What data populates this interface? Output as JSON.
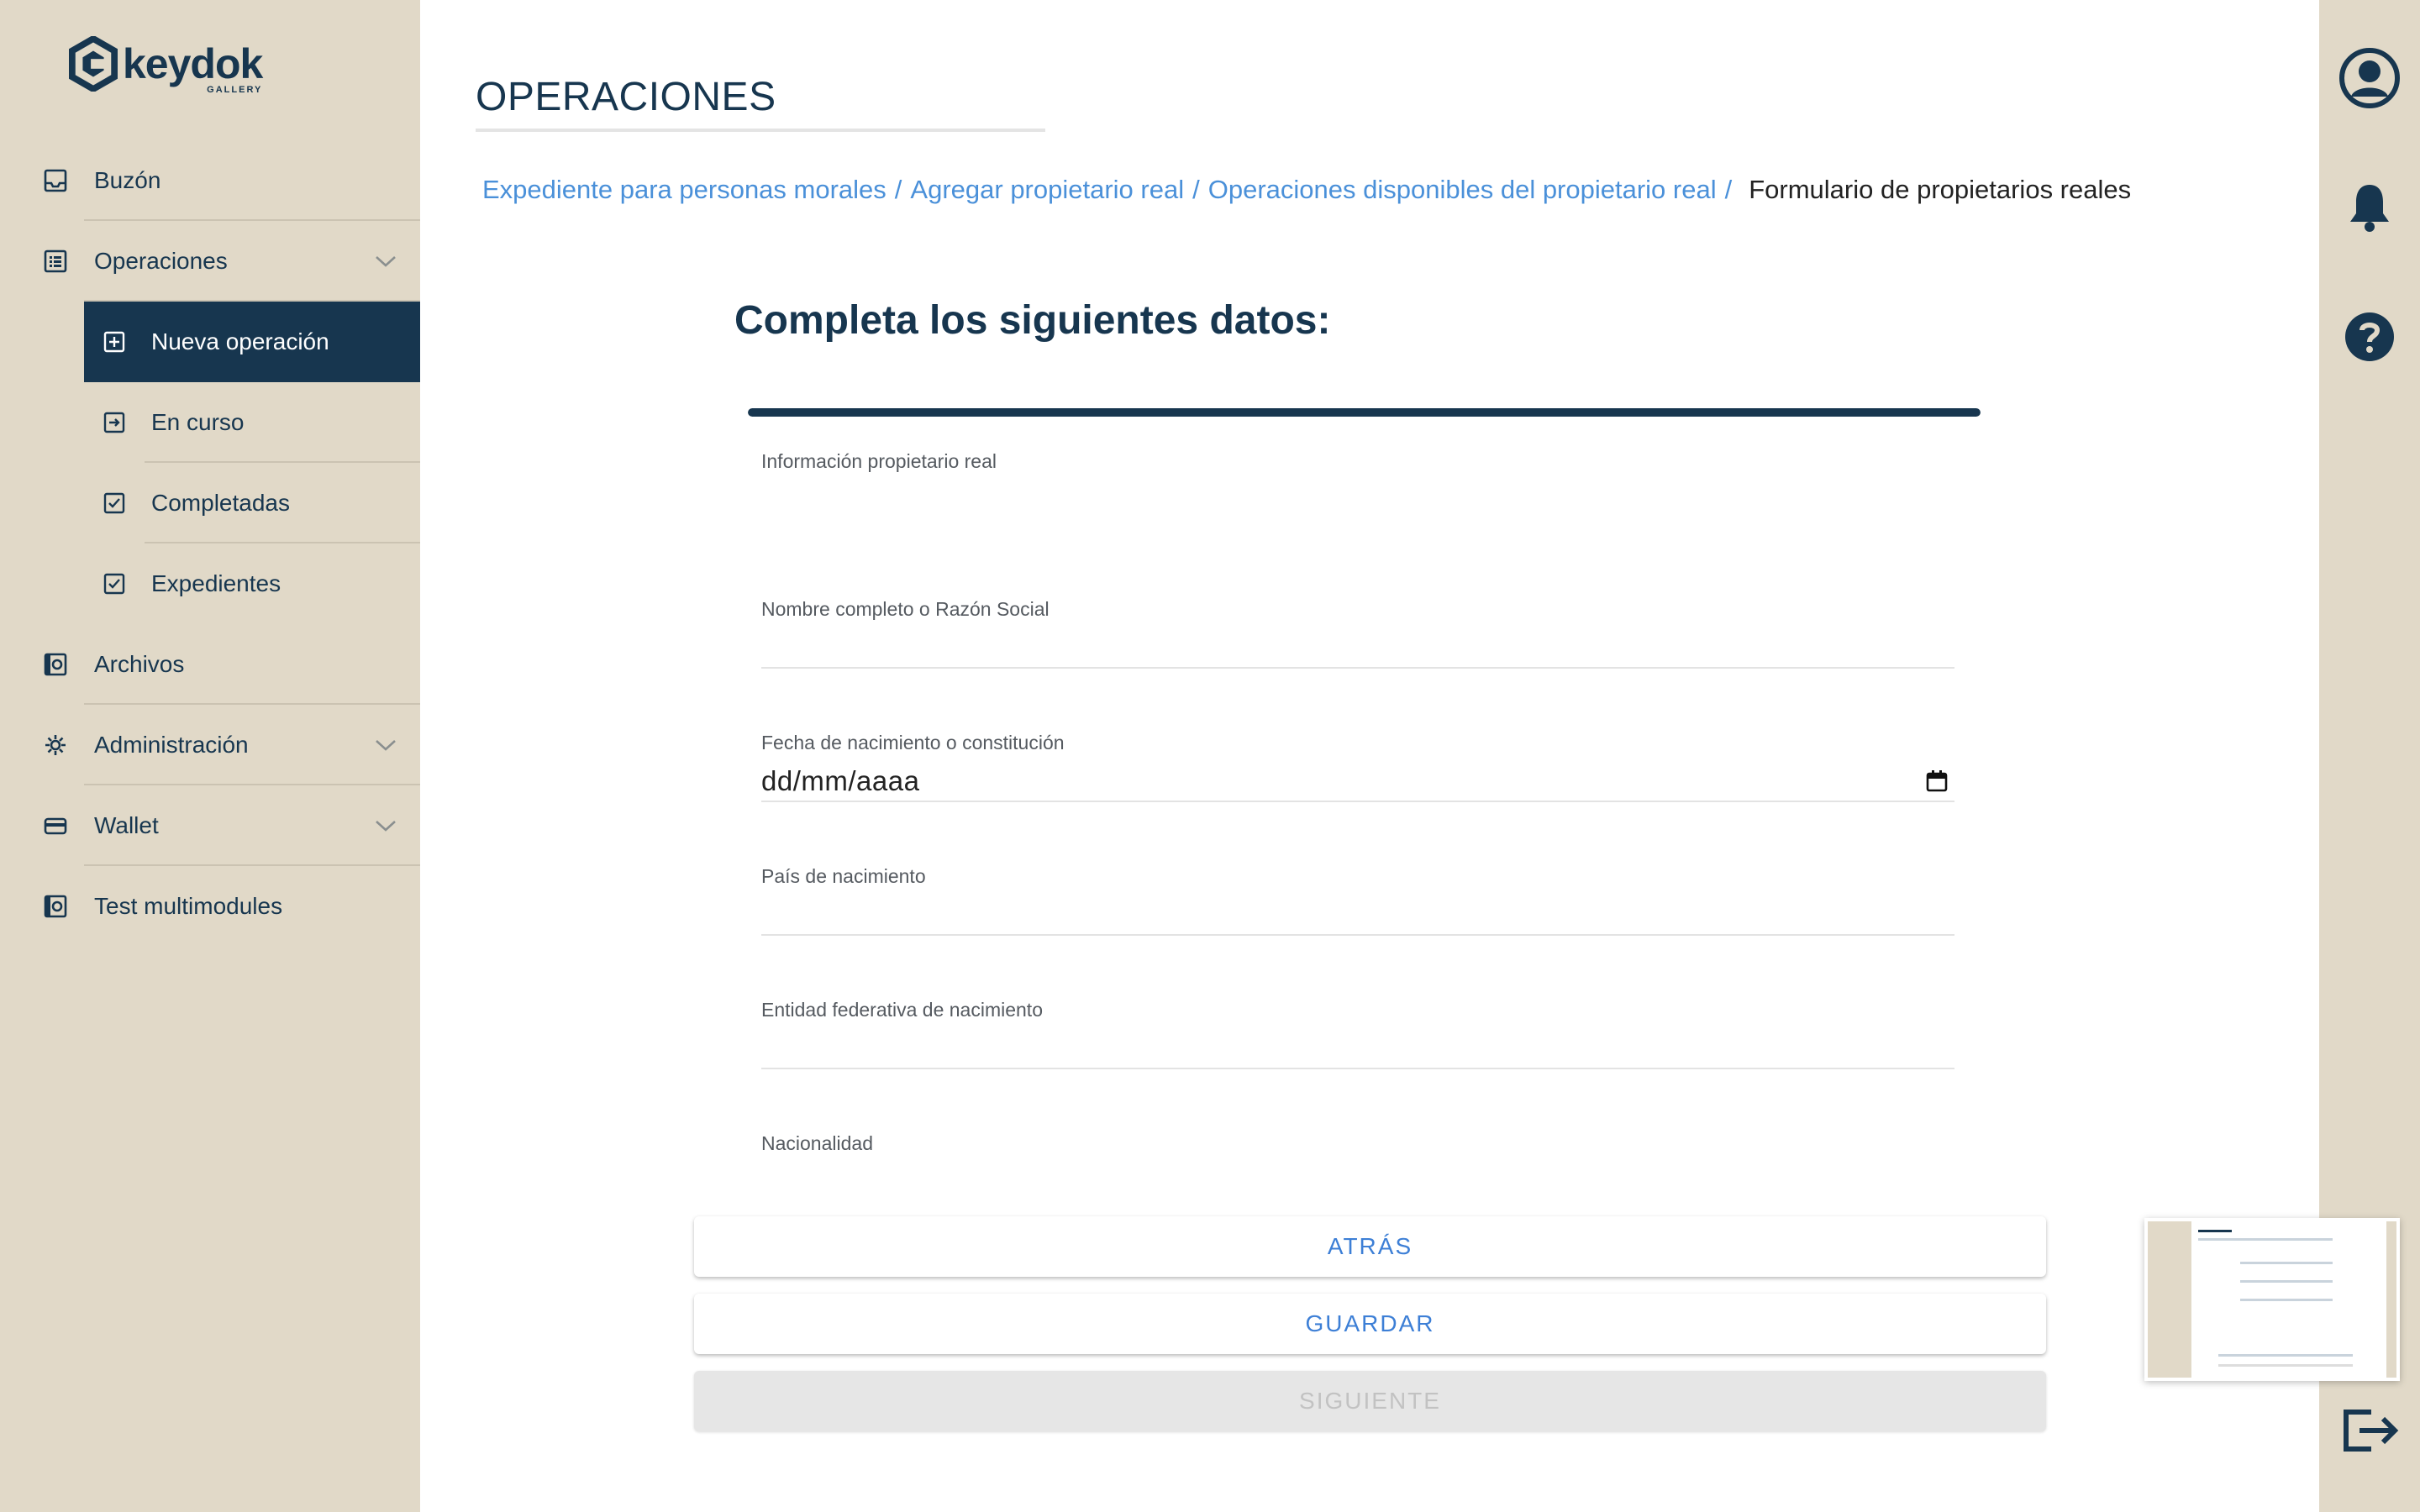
{
  "brand": {
    "name": "keydok",
    "subtitle": "GALLERY"
  },
  "sidebar": {
    "items": [
      {
        "label": "Buzón",
        "icon": "inbox-icon"
      },
      {
        "label": "Operaciones",
        "icon": "list-icon",
        "expanded": true
      },
      {
        "label": "Nueva operación",
        "icon": "plus-square-icon",
        "active": true
      },
      {
        "label": "En curso",
        "icon": "arrow-square-icon"
      },
      {
        "label": "Completadas",
        "icon": "check-square-icon"
      },
      {
        "label": "Expedientes",
        "icon": "check-square-icon"
      },
      {
        "label": "Archivos",
        "icon": "file-box-icon"
      },
      {
        "label": "Administración",
        "icon": "gear-icon",
        "expanded": false
      },
      {
        "label": "Wallet",
        "icon": "wallet-icon",
        "expanded": false
      },
      {
        "label": "Test multimodules",
        "icon": "file-box-icon"
      }
    ]
  },
  "header": {
    "title": "OPERACIONES"
  },
  "breadcrumb": {
    "items": [
      "Expediente para personas morales",
      "Agregar propietario real",
      "Operaciones disponibles del propietario real"
    ],
    "separator": "/",
    "current": "Formulario de propietarios reales"
  },
  "form": {
    "title": "Completa los siguientes datos:",
    "progress": 1.0,
    "section_label": "Información propietario real",
    "fields": {
      "name": {
        "label": "Nombre completo o Razón Social",
        "value": ""
      },
      "birth_date": {
        "label": "Fecha de nacimiento o constitución",
        "value": "dd/mm/aaaa"
      },
      "country": {
        "label": "País de nacimiento",
        "value": ""
      },
      "state": {
        "label": "Entidad federativa de nacimiento",
        "value": ""
      },
      "nationality": {
        "label": "Nacionalidad",
        "value": ""
      }
    }
  },
  "buttons": {
    "back": "ATRÁS",
    "save": "GUARDAR",
    "next": "SIGUIENTE"
  },
  "colors": {
    "sidebar_bg": "#e1d9c8",
    "primary": "#17364f",
    "link": "#4a90d9",
    "button_text": "#3d7fd6",
    "disabled_bg": "#e6e6e6"
  }
}
